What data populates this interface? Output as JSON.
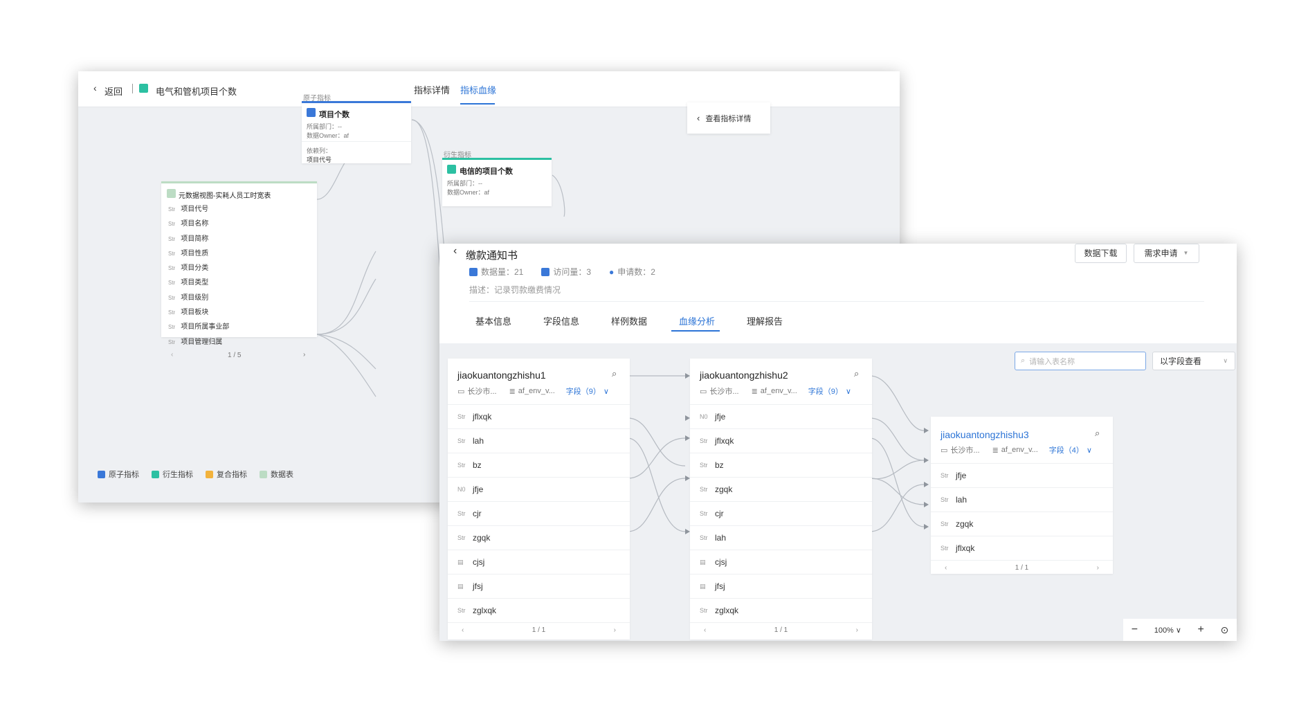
{
  "win_a": {
    "back_label": "返回",
    "title": "电气和管机项目个数",
    "tabs": [
      "指标详情",
      "指标血缘"
    ],
    "active_tab": 1,
    "view_detail_button": "查看指标详情",
    "atomic_section": "原子指标",
    "atomic_card": {
      "title": "项目个数",
      "dept": "所属部门：--",
      "owner": "数据Owner：af",
      "dep_col_label": "依赖列：",
      "dep_col_value": "项目代号"
    },
    "derived_section": "衍生指标",
    "derived_card": {
      "title": "电信的项目个数",
      "dept": "所属部门：--",
      "owner": "数据Owner：af"
    },
    "table_card": {
      "title": "元数据视图-实耗人员工时宽表",
      "rows": [
        "项目代号",
        "项目名称",
        "项目简称",
        "项目性质",
        "项目分类",
        "项目类型",
        "项目级别",
        "项目板块",
        "项目所属事业部",
        "项目管理归属"
      ],
      "type_label": "Str",
      "pager": "1 / 5"
    },
    "legend": [
      "原子指标",
      "衍生指标",
      "复合指标",
      "数据表"
    ],
    "colors": {
      "atomic": "#3a78d8",
      "derived": "#2cc0a2",
      "composite": "#f2b23c",
      "table": "#bcdcc4"
    }
  },
  "win_b": {
    "title": "缴款通知书",
    "download_button": "数据下载",
    "request_button": "需求申请",
    "meta_data_volume": "数据量：21",
    "meta_visits": "访问量：3",
    "meta_requests": "申请数：2",
    "description": "描述：记录罚款缴费情况",
    "tabs": [
      "基本信息",
      "字段信息",
      "样例数据",
      "血缘分析",
      "理解报告"
    ],
    "active_tab": 3,
    "search_placeholder": "请输入表名称",
    "view_by": "以字段查看",
    "zoom": "100%",
    "tables": [
      {
        "name": "jiaokuantongzhishu1",
        "location": "长沙市...",
        "db": "af_env_v...",
        "fields_label": "字段（9）",
        "fields": [
          {
            "type": "Str",
            "name": "jflxqk"
          },
          {
            "type": "Str",
            "name": "lah"
          },
          {
            "type": "Str",
            "name": "bz"
          },
          {
            "type": "N0",
            "name": "jfje"
          },
          {
            "type": "Str",
            "name": "cjr"
          },
          {
            "type": "Str",
            "name": "zgqk"
          },
          {
            "type": "date-icon",
            "name": "cjsj"
          },
          {
            "type": "date-icon",
            "name": "jfsj"
          },
          {
            "type": "Str",
            "name": "zglxqk"
          }
        ],
        "pager": "1 / 1"
      },
      {
        "name": "jiaokuantongzhishu2",
        "location": "长沙市...",
        "db": "af_env_v...",
        "fields_label": "字段（9）",
        "fields": [
          {
            "type": "N0",
            "name": "jfje"
          },
          {
            "type": "Str",
            "name": "jflxqk"
          },
          {
            "type": "Str",
            "name": "bz"
          },
          {
            "type": "Str",
            "name": "zgqk"
          },
          {
            "type": "Str",
            "name": "cjr"
          },
          {
            "type": "Str",
            "name": "lah"
          },
          {
            "type": "date-icon",
            "name": "cjsj"
          },
          {
            "type": "date-icon",
            "name": "jfsj"
          },
          {
            "type": "Str",
            "name": "zglxqk"
          }
        ],
        "pager": "1 / 1"
      },
      {
        "name": "jiaokuantongzhishu3",
        "location": "长沙市...",
        "db": "af_env_v...",
        "fields_label": "字段（4）",
        "fields": [
          {
            "type": "Str",
            "name": "jfje"
          },
          {
            "type": "Str",
            "name": "lah"
          },
          {
            "type": "Str",
            "name": "zgqk"
          },
          {
            "type": "Str",
            "name": "jflxqk"
          }
        ],
        "pager": "1 / 1"
      }
    ],
    "accent": "#2c74d6"
  }
}
